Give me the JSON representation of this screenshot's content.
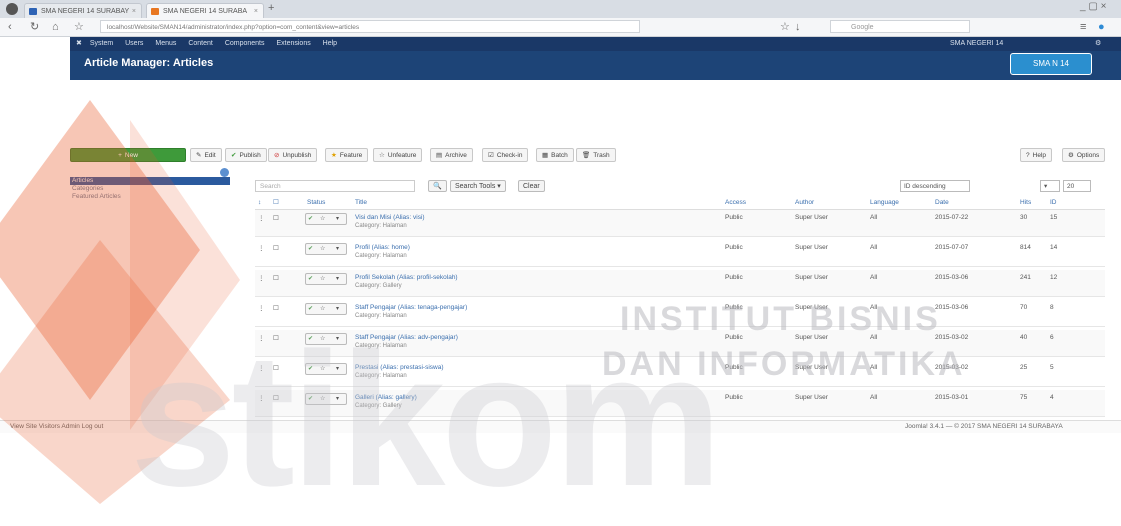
{
  "browser": {
    "tabs": [
      {
        "label": "SMA NEGERI 14 SURABAY"
      },
      {
        "label": "SMA NEGERI 14 SURABA"
      }
    ],
    "url": "localhost/Website/SMAN14/administrator/index.php?option=com_content&view=articles",
    "search_placeholder": "Google"
  },
  "joomla": {
    "menu": [
      "System",
      "Users",
      "Menus",
      "Content",
      "Components",
      "Extensions",
      "Help"
    ],
    "site_name": "SMA NEGERI 14",
    "page_title": "Article Manager: Articles",
    "logo_text": "SMA N 14"
  },
  "toolbar": {
    "new": "New",
    "edit": "Edit",
    "publish": "Publish",
    "unpublish": "Unpublish",
    "feature": "Feature",
    "unfeature": "Unfeature",
    "archive": "Archive",
    "checkin": "Check-in",
    "batch": "Batch",
    "trash": "Trash",
    "help": "Help",
    "options": "Options"
  },
  "sidebar": {
    "items": [
      {
        "label": "Articles"
      },
      {
        "label": "Categories"
      },
      {
        "label": "Featured Articles"
      }
    ]
  },
  "filters": {
    "search_placeholder": "Search",
    "search_tools": "Search Tools",
    "clear": "Clear",
    "ordering": "ID descending",
    "limit": "20"
  },
  "table": {
    "headers": {
      "status": "Status",
      "title": "Title",
      "access": "Access",
      "author": "Author",
      "language": "Language",
      "date": "Date",
      "hits": "Hits",
      "id": "ID"
    },
    "rows": [
      {
        "title": "Visi dan Misi (Alias: visi)",
        "category": "Category: Halaman",
        "access": "Public",
        "author": "Super User",
        "language": "All",
        "date": "2015-07-22",
        "hits": "30",
        "id": "15"
      },
      {
        "title": "Profil (Alias: home)",
        "category": "Category: Halaman",
        "access": "Public",
        "author": "Super User",
        "language": "All",
        "date": "2015-07-07",
        "hits": "814",
        "id": "14"
      },
      {
        "title": "Profil Sekolah (Alias: profil-sekolah)",
        "category": "Category: Gallery",
        "access": "Public",
        "author": "Super User",
        "language": "All",
        "date": "2015-03-06",
        "hits": "241",
        "id": "12"
      },
      {
        "title": "Staff Pengajar (Alias: tenaga-pengajar)",
        "category": "Category: Halaman",
        "access": "Public",
        "author": "Super User",
        "language": "All",
        "date": "2015-03-06",
        "hits": "70",
        "id": "8"
      },
      {
        "title": "Staff Pengajar (Alias: adv-pengajar)",
        "category": "Category: Halaman",
        "access": "Public",
        "author": "Super User",
        "language": "All",
        "date": "2015-03-02",
        "hits": "40",
        "id": "6"
      },
      {
        "title": "Prestasi (Alias: prestasi-siswa)",
        "category": "Category: Halaman",
        "access": "Public",
        "author": "Super User",
        "language": "All",
        "date": "2015-03-02",
        "hits": "25",
        "id": "5"
      },
      {
        "title": "Galleri (Alias: gallery)",
        "category": "Category: Gallery",
        "access": "Public",
        "author": "Super User",
        "language": "All",
        "date": "2015-03-01",
        "hits": "75",
        "id": "4"
      }
    ]
  },
  "footer": {
    "left": "View Site   Visitors   Admin   Log out",
    "right": "Joomla! 3.4.1 — © 2017 SMA NEGERI 14 SURABAYA"
  },
  "watermark": {
    "line1": "INSTITUT BISNIS",
    "line2": "DAN INFORMATIKA",
    "big": "stikom"
  }
}
